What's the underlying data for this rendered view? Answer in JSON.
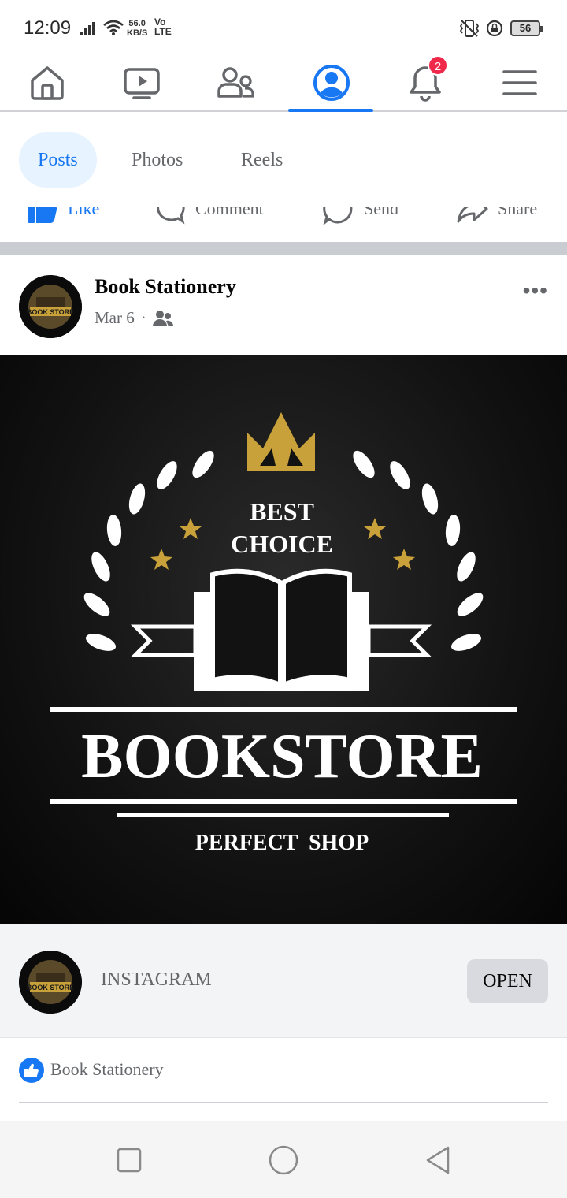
{
  "status_bar": {
    "time": "12:09",
    "net_speed_value": "56.0",
    "net_speed_unit": "KB/S",
    "volte_top": "Vo",
    "volte_bottom": "LTE",
    "battery": "56"
  },
  "top_nav": {
    "items": [
      {
        "name": "home-icon"
      },
      {
        "name": "watch-video-icon"
      },
      {
        "name": "friends-icon"
      },
      {
        "name": "profile-icon",
        "active": true
      },
      {
        "name": "notifications-bell-icon",
        "badge": "2"
      },
      {
        "name": "menu-hamburger-icon"
      }
    ],
    "accent": "#1877f2"
  },
  "tabs": [
    {
      "label": "Posts",
      "active": true
    },
    {
      "label": "Photos"
    },
    {
      "label": "Reels"
    }
  ],
  "action_row": {
    "like": "Like",
    "comment": "Comment",
    "send": "Send",
    "share": "Share"
  },
  "post": {
    "author": "Book Stationery",
    "date": "Mar 6",
    "separator": "·",
    "audience_icon": "friends-audience-icon",
    "avatar_text": "BOOK STORE",
    "image": {
      "top_line1": "BEST",
      "top_line2": "CHOICE",
      "title": "BOOKSTORE",
      "subtitle": "PERFECT  SHOP"
    },
    "link_card": {
      "site": "INSTAGRAM",
      "button": "OPEN"
    },
    "reactions": {
      "names": "Book Stationery"
    }
  }
}
